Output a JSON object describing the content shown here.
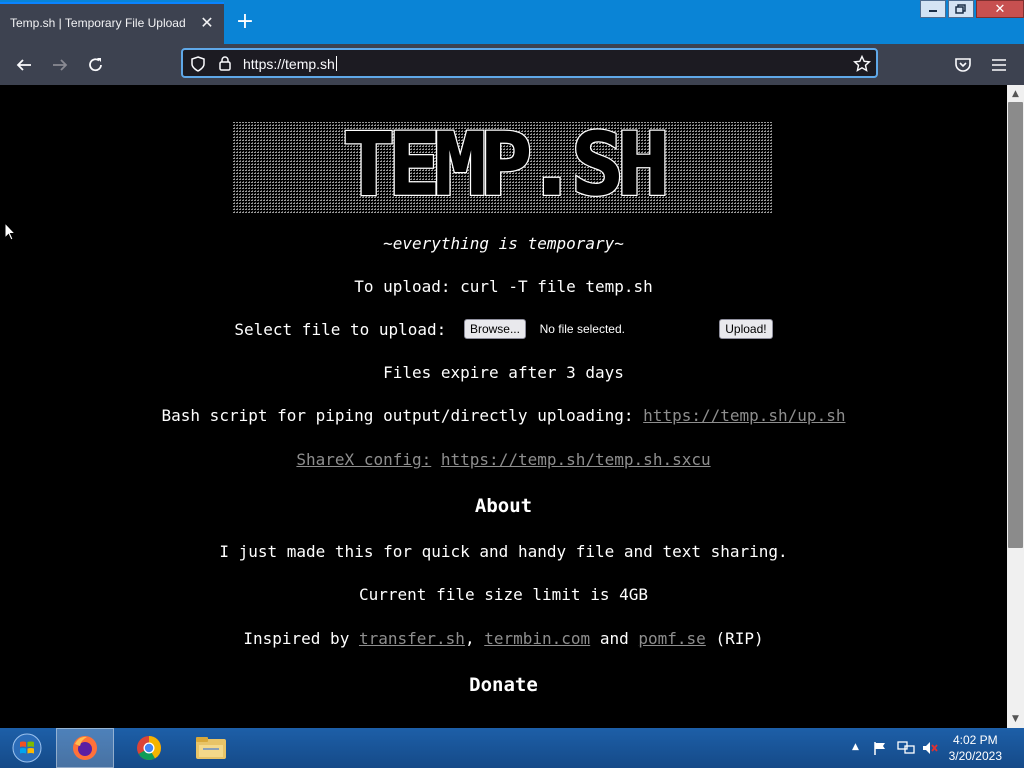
{
  "browser": {
    "tab_title": "Temp.sh | Temporary File Upload",
    "url": "https://temp.sh",
    "accent": "#0a84ff"
  },
  "icons": [
    "close-icon",
    "plus-icon",
    "minimize-icon",
    "maximize-icon",
    "back-icon",
    "forward-icon",
    "reload-icon",
    "shield-icon",
    "lock-icon",
    "star-icon",
    "pocket-icon",
    "menu-icon",
    "windows-start-icon",
    "firefox-icon",
    "chrome-icon",
    "file-explorer-icon",
    "flag-icon",
    "network-icon",
    "volume-muted-icon"
  ],
  "page": {
    "logo_text": "TEMP.SH",
    "tagline": "~everything is temporary~",
    "curl_instructions": "To upload: curl -T file temp.sh",
    "select_label": "Select file to upload:",
    "browse_label": "Browse...",
    "no_file_text": "No file selected.",
    "upload_label": "Upload!",
    "expiry": "Files expire after 3 days",
    "bash_label": "Bash script for piping output/directly uploading:",
    "bash_link": "https://temp.sh/up.sh",
    "sharex_label": "ShareX config:",
    "sharex_link": "https://temp.sh/temp.sh.sxcu",
    "about_heading": "About",
    "about_text": "I just made this for quick and handy file and text sharing.",
    "limit_text": "Current file size limit is 4GB",
    "inspired_prefix": "Inspired by",
    "inspired_links": [
      "transfer.sh",
      "termbin.com",
      "pomf.se"
    ],
    "inspired_sep1": ",",
    "inspired_and": "and",
    "inspired_suffix": "(RIP)",
    "donate_heading": "Donate"
  },
  "taskbar": {
    "time": "4:02 PM",
    "date": "3/20/2023"
  }
}
